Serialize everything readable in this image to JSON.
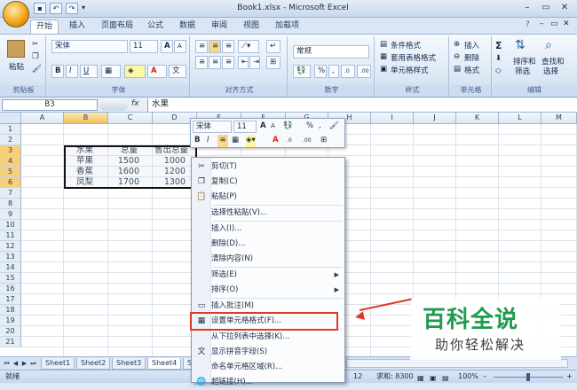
{
  "window": {
    "title": "Book1.xlsx - Microsoft Excel",
    "qat": [
      "save",
      "undo",
      "redo"
    ],
    "controls": [
      "–",
      "▭",
      "✕"
    ],
    "ribbon_controls": [
      "?",
      "–",
      "▭",
      "✕"
    ]
  },
  "tabs": [
    "开始",
    "插入",
    "页面布局",
    "公式",
    "数据",
    "审阅",
    "视图",
    "加载项"
  ],
  "ribbon": {
    "clipboard": {
      "label": "剪贴板",
      "paste": "粘贴"
    },
    "font": {
      "label": "字体",
      "font_name": "宋体",
      "font_size": "11",
      "bold": "B",
      "italic": "I",
      "underline": "U",
      "grow": "A",
      "shrink": "A",
      "font_color": "A"
    },
    "alignment": {
      "label": "对齐方式"
    },
    "number": {
      "label": "数字",
      "format": "常规",
      "percent": "%",
      "comma": ","
    },
    "styles": {
      "label": "样式",
      "conditional": "条件格式",
      "table_format": "套用表格格式",
      "cell_styles": "单元格样式"
    },
    "cells": {
      "label": "单元格",
      "insert": "插入",
      "delete": "删除",
      "format": "格式"
    },
    "editing": {
      "label": "编辑",
      "sum": "Σ",
      "sort_line1": "排序和",
      "sort_line2": "筛选",
      "find_line1": "查找和",
      "find_line2": "选择"
    }
  },
  "formula_bar": {
    "name_box": "B3",
    "fx": "fx",
    "content": "水果"
  },
  "columns": [
    "A",
    "B",
    "C",
    "D",
    "E",
    "F",
    "G",
    "H",
    "I",
    "J",
    "K",
    "L",
    "M"
  ],
  "rows": [
    "1",
    "2",
    "3",
    "4",
    "5",
    "6",
    "7",
    "8",
    "9",
    "10",
    "11",
    "12",
    "13",
    "14",
    "15",
    "16",
    "17",
    "18",
    "19",
    "20",
    "21"
  ],
  "table": {
    "header": [
      "水果",
      "总量",
      "售出总量"
    ],
    "rows": [
      [
        "苹果",
        "1500",
        "1000"
      ],
      [
        "香蕉",
        "1600",
        "1200"
      ],
      [
        "凤梨",
        "1700",
        "1300"
      ]
    ]
  },
  "mini_toolbar": {
    "font": "宋体",
    "size": "11",
    "grow": "A",
    "shrink": "A",
    "percent": "%",
    "comma": ",",
    "bold": "B",
    "italic": "I",
    "font_color": "A",
    "inc_decimal": ".0",
    "dec_decimal": ".00"
  },
  "context_menu": [
    {
      "label": "剪切(T)",
      "icon": "scissors-icon",
      "glyph": "✂"
    },
    {
      "label": "复制(C)",
      "icon": "copy-icon",
      "glyph": "❐"
    },
    {
      "label": "粘贴(P)",
      "icon": "paste-icon",
      "glyph": "📋"
    },
    {
      "label": "选择性粘贴(V)...",
      "icon": "",
      "glyph": ""
    },
    {
      "label": "插入(I)...",
      "icon": "",
      "glyph": ""
    },
    {
      "label": "删除(D)...",
      "icon": "",
      "glyph": ""
    },
    {
      "label": "清除内容(N)",
      "icon": "",
      "glyph": ""
    },
    {
      "label": "筛选(E)",
      "icon": "",
      "glyph": "",
      "submenu": true
    },
    {
      "label": "排序(O)",
      "icon": "",
      "glyph": "",
      "submenu": true
    },
    {
      "label": "插入批注(M)",
      "icon": "comment-icon",
      "glyph": "▭"
    },
    {
      "label": "设置单元格格式(F)...",
      "icon": "format-cells-icon",
      "glyph": "▦"
    },
    {
      "label": "从下拉列表中选择(K)...",
      "icon": "",
      "glyph": ""
    },
    {
      "label": "显示拼音字段(S)",
      "icon": "phonetic-icon",
      "glyph": "文"
    },
    {
      "label": "命名单元格区域(R)...",
      "icon": "",
      "glyph": ""
    },
    {
      "label": "超链接(H)...",
      "icon": "hyperlink-icon",
      "glyph": "🌐"
    }
  ],
  "sheets": [
    "Sheet1",
    "Sheet2",
    "Sheet3",
    "Sheet4",
    "S"
  ],
  "status": {
    "ready": "就绪",
    "count": "12",
    "sum": "求和: 8300",
    "zoom": "100%",
    "minus": "–",
    "plus": "+"
  },
  "watermark": {
    "title": "百科全说",
    "subtitle": "助你轻松解决"
  },
  "colors": {
    "accent": "#e03a25",
    "watermark": "#1f9b4f",
    "ribbon": "#dbe7f5"
  }
}
